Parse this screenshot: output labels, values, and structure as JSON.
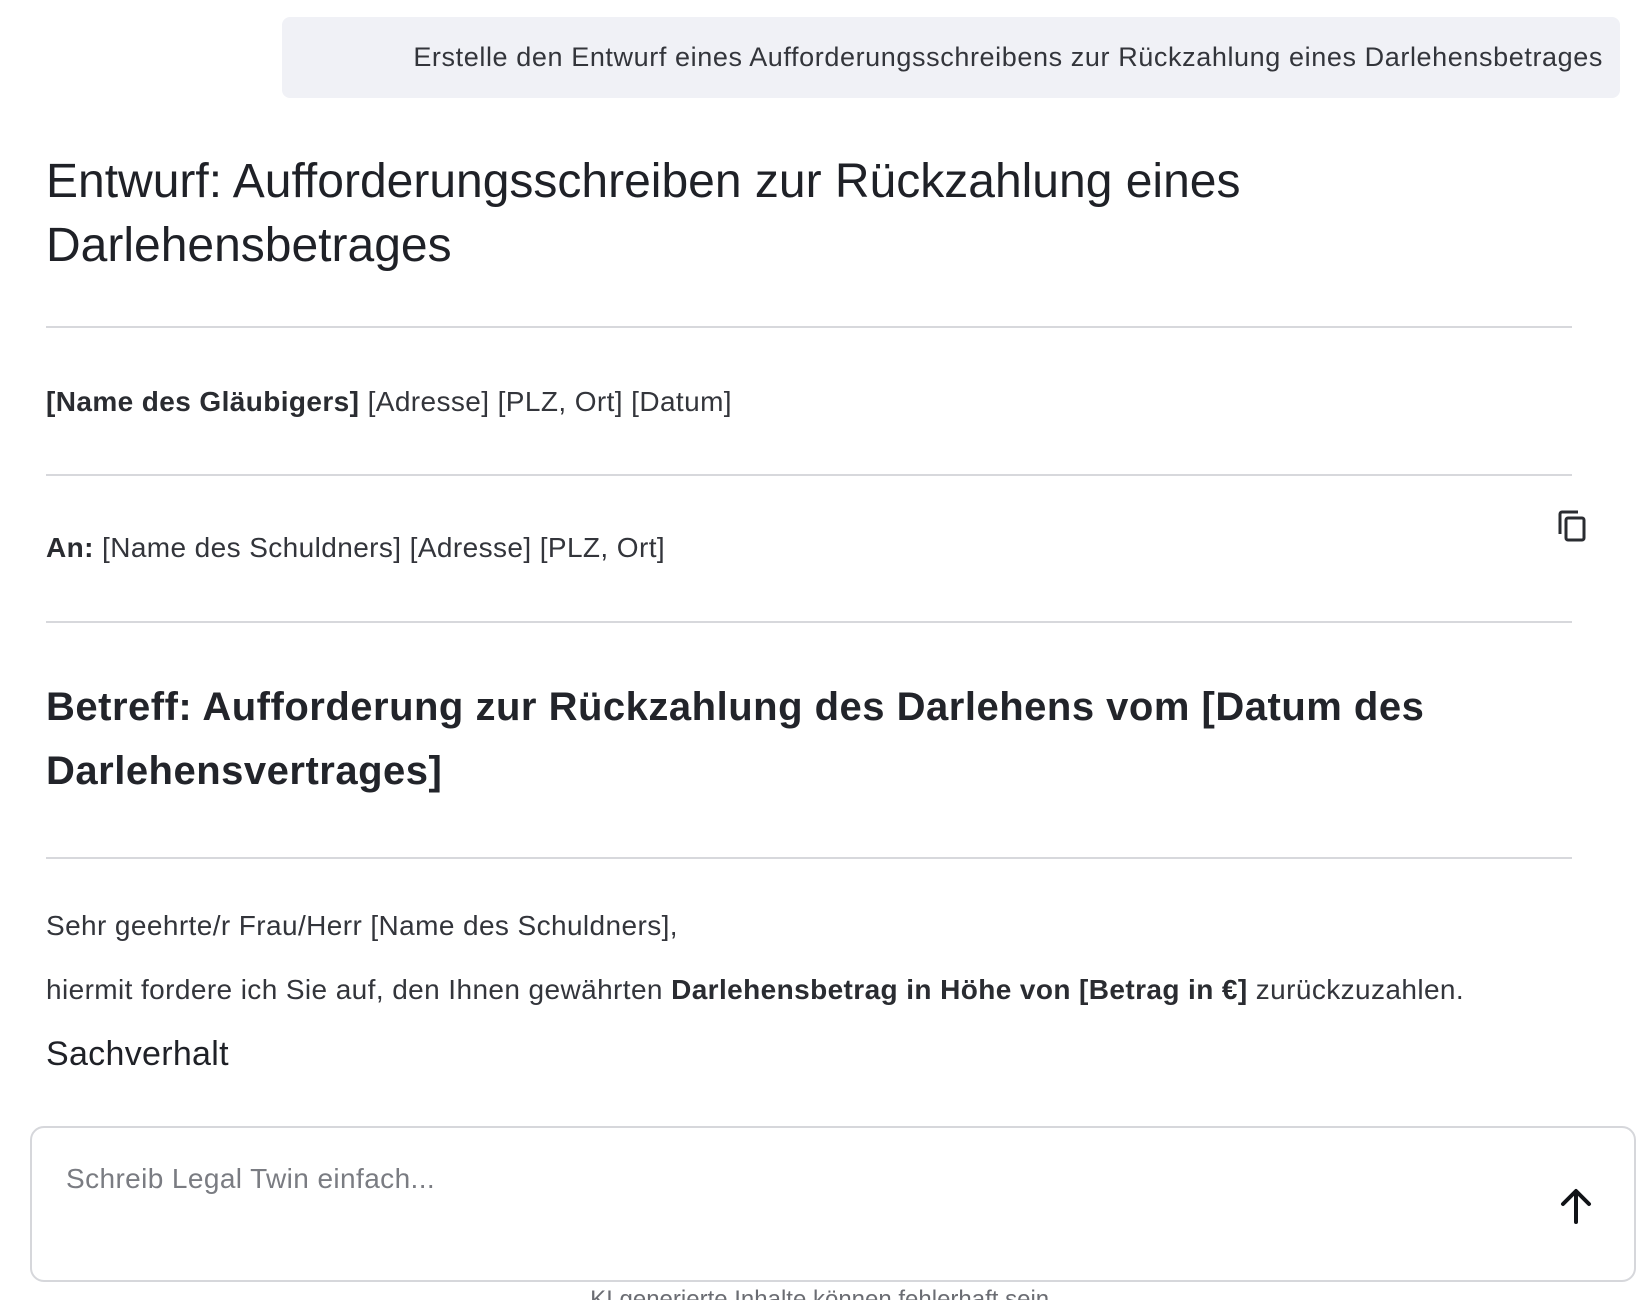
{
  "user_message": {
    "text": "Erstelle den Entwurf eines Aufforderungsschreibens zur Rückzahlung eines Darlehensbetrages"
  },
  "response": {
    "title": "Entwurf: Aufforderungsschreiben zur Rückzahlung eines Darlehensbetrages",
    "sender": {
      "name": "[Name des Gläubigers]",
      "details": " [Adresse] [PLZ, Ort] [Datum]"
    },
    "recipient": {
      "label": "An:",
      "details": " [Name des Schuldners] [Adresse] [PLZ, Ort]"
    },
    "copy_icon": "copy-icon",
    "subject": "Betreff: Aufforderung zur Rückzahlung des Darlehens vom [Datum des Darlehensvertrages]",
    "greeting": "Sehr geehrte/r Frau/Herr [Name des Schuldners],",
    "body": {
      "before": "hiermit fordere ich Sie auf, den Ihnen gewährten ",
      "bold": "Darlehensbetrag in Höhe von [Betrag in €]",
      "after": " zurückzuzahlen."
    },
    "section_heading": "Sachverhalt"
  },
  "composer": {
    "placeholder": "Schreib Legal Twin einfach...",
    "value": "",
    "send_icon": "arrow-up-icon"
  },
  "footer": {
    "disclaimer": "KI generierte Inhalte können fehlerhaft sein."
  }
}
